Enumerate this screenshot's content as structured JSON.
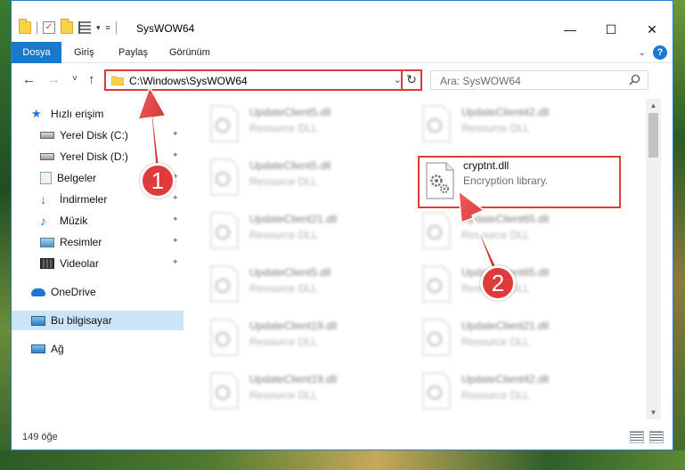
{
  "window": {
    "title": "SysWOW64",
    "controls": {
      "minimize": "—",
      "maximize": "☐",
      "close": "✕"
    }
  },
  "ribbon": {
    "tabs": [
      "Dosya",
      "Giriş",
      "Paylaş",
      "Görünüm"
    ],
    "help": "?"
  },
  "nav": {
    "back": "←",
    "forward": "→",
    "recent": "˅",
    "up": "↑",
    "address_path": "C:\\Windows\\SysWOW64",
    "refresh": "↻",
    "search_placeholder": "Ara: SysWOW64"
  },
  "sidebar": {
    "items": [
      {
        "label": "Hızlı erişim",
        "icon": "star-icon"
      },
      {
        "label": "Yerel Disk (C:)",
        "icon": "drive-icon",
        "pinned": true
      },
      {
        "label": "Yerel Disk (D:)",
        "icon": "drive-icon",
        "pinned": true
      },
      {
        "label": "Belgeler",
        "icon": "documents-icon",
        "pinned": true
      },
      {
        "label": "İndirmeler",
        "icon": "download-icon",
        "pinned": true
      },
      {
        "label": "Müzik",
        "icon": "music-icon",
        "pinned": true
      },
      {
        "label": "Resimler",
        "icon": "pictures-icon",
        "pinned": true
      },
      {
        "label": "Videolar",
        "icon": "videos-icon",
        "pinned": true
      },
      {
        "label": "OneDrive",
        "icon": "cloud-icon"
      },
      {
        "label": "Bu bilgisayar",
        "icon": "computer-icon",
        "selected": true
      },
      {
        "label": "Ağ",
        "icon": "network-icon"
      }
    ]
  },
  "files": {
    "left": [
      {
        "name": "UpdateClient5.dll",
        "desc": "Resource DLL"
      },
      {
        "name": "UpdateClient5.dll",
        "desc": "Resource DLL"
      },
      {
        "name": "UpdateClient21.dll",
        "desc": "Resource DLL"
      },
      {
        "name": "UpdateClient5.dll",
        "desc": "Resource DLL"
      },
      {
        "name": "UpdateClient19.dll",
        "desc": "Resource DLL"
      },
      {
        "name": "UpdateClient19.dll",
        "desc": "Resource DLL"
      }
    ],
    "right": [
      {
        "name": "UpdateClient42.dll",
        "desc": "Resource DLL"
      },
      {
        "name": "cryptnt.dll",
        "desc": "Encryption library."
      },
      {
        "name": "UpdateClient65.dll",
        "desc": "Resource DLL"
      },
      {
        "name": "UpdateClient65.dll",
        "desc": "Resource DLL"
      },
      {
        "name": "UpdateClient21.dll",
        "desc": "Resource DLL"
      },
      {
        "name": "UpdateClient42.dll",
        "desc": "Resource DLL"
      }
    ]
  },
  "status": {
    "item_count": "149 öğe"
  },
  "callouts": {
    "one": "1",
    "two": "2"
  },
  "colors": {
    "accent": "#1979ca",
    "highlight": "#e03b3b",
    "selected_bg": "#cce4f7"
  }
}
